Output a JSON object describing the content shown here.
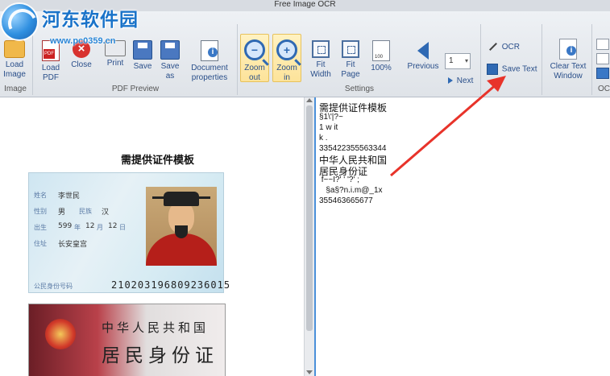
{
  "window": {
    "title": "Free Image OCR"
  },
  "watermark": {
    "name": "河东软件园",
    "url": "www.pc0359.cn"
  },
  "ribbon": {
    "image_group": {
      "label": "Image",
      "load_image": "Load Image"
    },
    "pdf_group": {
      "label": "PDF Preview",
      "load_pdf": "Load PDF",
      "close": "Close",
      "print": "Print",
      "save": "Save",
      "save_as": "Save as",
      "document_properties": "Document properties"
    },
    "settings_group": {
      "label": "Settings",
      "zoom_out": "Zoom out",
      "zoom_in": "Zoom in",
      "fit_width": "Fit Width",
      "fit_page": "Fit Page",
      "percent_100": "100%"
    },
    "nav": {
      "previous": "Previous",
      "next": "Next",
      "page_value": "1"
    },
    "ocr_group": {
      "ocr": "OCR",
      "save_text": "Save Text",
      "clear_text_window": "Clear Text Window",
      "label_partial": "OC"
    }
  },
  "document": {
    "title": "需提供证件模板",
    "front": {
      "name_label": "姓名",
      "name_value": "李世民",
      "sex_label": "性别",
      "sex_value": "男",
      "nation_label": "民族",
      "nation_value": "汉",
      "birth_label": "出生",
      "birth_year": "599",
      "birth_month_label": "年",
      "birth_month": "12",
      "birth_day_label": "月",
      "birth_day": "12",
      "birth_day_suffix": "日",
      "address_label": "住址",
      "address_value": "长安皇宫",
      "id_label": "公民身份号码",
      "id_number": "210203196809236015"
    },
    "back": {
      "line1": "中华人民共和国",
      "line2": "居民身份证"
    }
  },
  "ocr_text": [
    "需提供证件模板",
    "§1\\'|?~",
    "1 w it",
    "k .",
    "335422355563344",
    "中华人民共和国",
    "居民身份证",
    " f~~I?' ' '?' ;",
    "   §a§?n.i.m@_1x",
    "355463665677"
  ],
  "colors": {
    "accent": "#2f69b3",
    "arrow": "#e8332a",
    "divider": "#4a90d9"
  }
}
